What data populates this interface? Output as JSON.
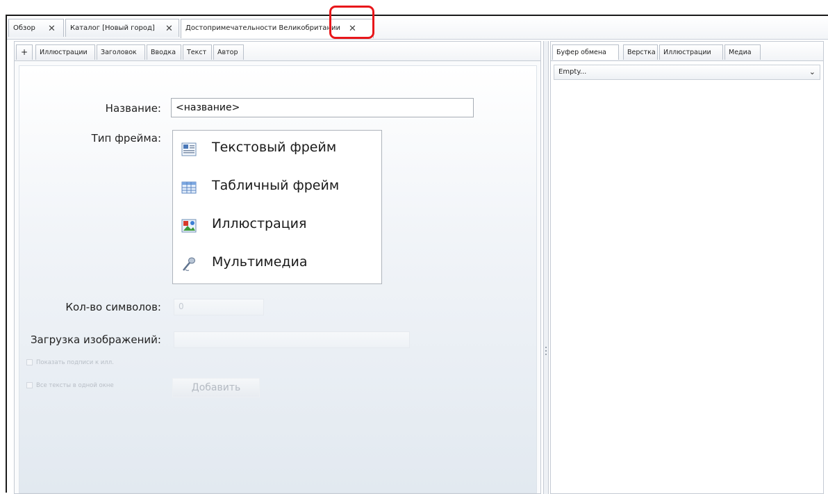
{
  "doc_tabs": [
    {
      "label": "Обзор"
    },
    {
      "label": "Каталог [Новый город]"
    },
    {
      "label": "Достопримечательности Великобритании"
    }
  ],
  "sub_tabs": [
    "+",
    "Иллюстрации",
    "Заголовок",
    "Вводка",
    "Текст",
    "Автор"
  ],
  "form": {
    "name_label": "Название:",
    "name_value": "<название>",
    "frame_type_label": "Тип фрейма:",
    "frame_types": [
      {
        "label": "Текстовый фрейм",
        "icon": "text-frame-icon"
      },
      {
        "label": "Табличный фрейм",
        "icon": "table-frame-icon"
      },
      {
        "label": "Иллюстрация",
        "icon": "illustration-icon"
      },
      {
        "label": "Мультимедиа",
        "icon": "microphone-icon"
      }
    ],
    "char_count_label": "Кол-во символов:",
    "char_count_value": "0",
    "image_load_label": "Загрузка изображений:",
    "show_captions_label": "Показать подписи к илл.",
    "all_texts_one_window_label": "Все тексты в одной окне",
    "add_button": "Добавить"
  },
  "right_tabs": [
    "Буфер обмена",
    "Верстка",
    "Иллюстрации",
    "Медиа"
  ],
  "clipboard_dropdown": {
    "value": "Empty..."
  },
  "colors": {
    "annotation": "#e8161a",
    "panel_bg": "#e2e9f0"
  }
}
